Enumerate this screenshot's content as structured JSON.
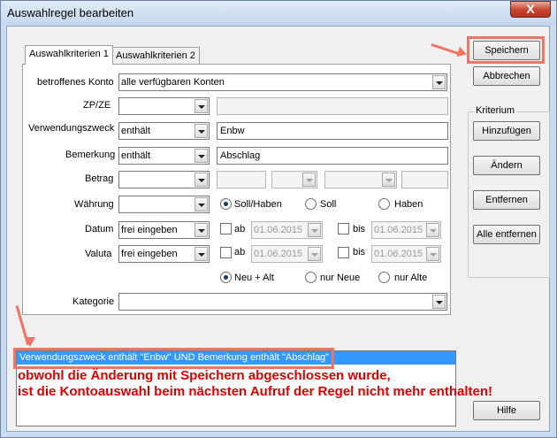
{
  "window": {
    "title": "Auswahlregel bearbeiten",
    "close_glyph": "X"
  },
  "tabs": [
    {
      "label": "Auswahlkriterien 1",
      "active": true
    },
    {
      "label": "Auswahlkriterien 2",
      "active": false
    }
  ],
  "form": {
    "konto_label": "betroffenes Konto",
    "konto_value": "alle verfügbaren Konten",
    "zpze_label": "ZP/ZE",
    "zpze_value": "",
    "zweck_label": "Verwendungszweck",
    "zweck_op": "enthält",
    "zweck_text": "Enbw",
    "bemerkung_label": "Bemerkung",
    "bemerkung_op": "enthält",
    "bemerkung_text": "Abschlag",
    "betrag_label": "Betrag",
    "waehrung_label": "Währung",
    "waehrung_options": [
      "Soll/Haben",
      "Soll",
      "Haben"
    ],
    "waehrung_selected": "Soll/Haben",
    "datum_label": "Datum",
    "datum_mode": "frei eingeben",
    "valuta_label": "Valuta",
    "valuta_mode": "frei eingeben",
    "ab_label": "ab",
    "bis_label": "bis",
    "datum_ab": "01.06.2015",
    "datum_bis": "01.06.2015",
    "valuta_ab": "01.06.2015",
    "valuta_bis": "01.06.2015",
    "neu_options": [
      "Neu + Alt",
      "nur Neue",
      "nur Alte"
    ],
    "neu_selected": "Neu + Alt",
    "kategorie_label": "Kategorie",
    "kategorie_value": ""
  },
  "buttons": {
    "speichern": "Speichern",
    "abbrechen": "Abbrechen",
    "hinzufuegen": "Hinzufügen",
    "aendern": "Ändern",
    "entfernen": "Entfernen",
    "alle_entfernen": "Alle entfernen",
    "hilfe": "Hilfe"
  },
  "kriterium_group_label": "Kriterium",
  "criteria_list": [
    "Verwendungszweck enthält \"Enbw\" UND Bemerkung enthält \"Abschlag\""
  ],
  "annotation": {
    "line1": "obwohl die Änderung mit Speichern abgeschlossen wurde,",
    "line2": "ist die Kontoauswahl beim nächsten Aufruf der Regel nicht mehr enthalten!",
    "color": "#ee7466"
  }
}
